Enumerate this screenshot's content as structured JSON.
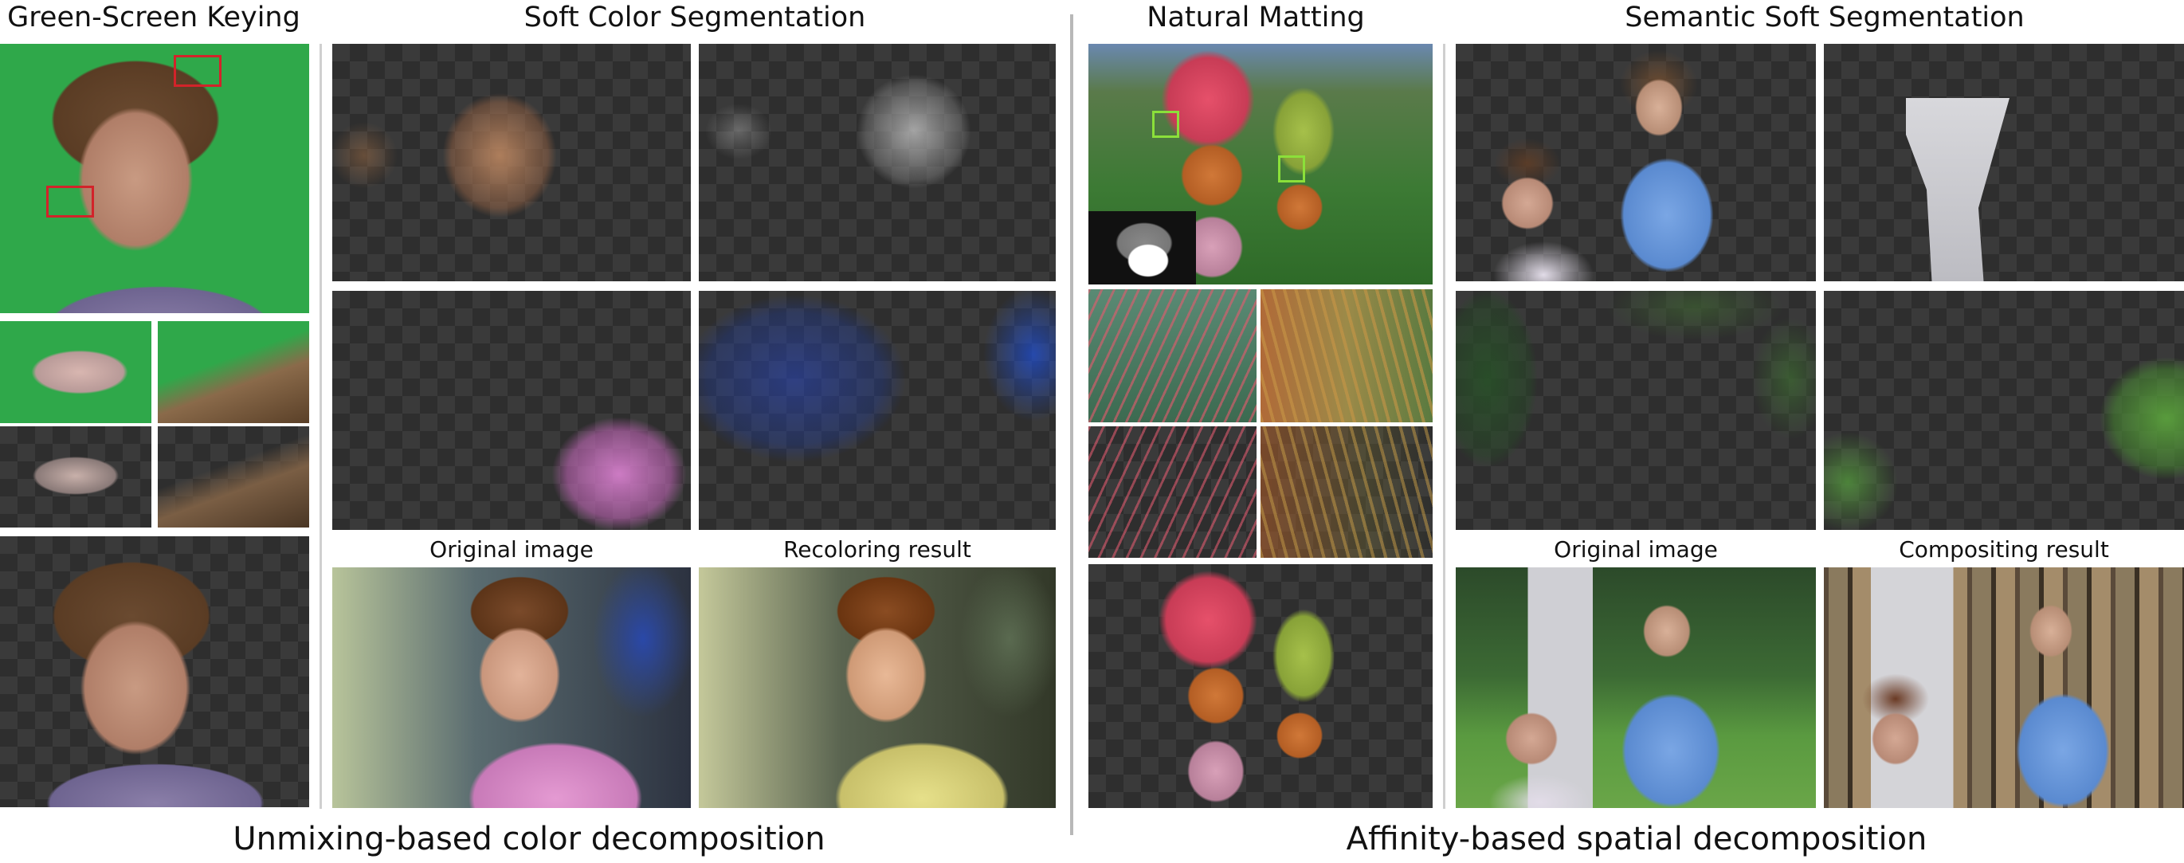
{
  "headings": {
    "green_screen": "Green-Screen Keying",
    "soft_color": "Soft Color Segmentation",
    "natural_matting": "Natural Matting",
    "semantic_soft": "Semantic Soft Segmentation"
  },
  "sublabels": {
    "original_left": "Original image",
    "recoloring": "Recoloring result",
    "original_right": "Original image",
    "compositing": "Compositing result"
  },
  "captions": {
    "left": "Unmixing-based color decomposition",
    "right": "Affinity-based spatial decomposition"
  },
  "colors": {
    "green_screen": "#2fa84a",
    "box_red": "#d2232a",
    "box_green": "#8be03a",
    "checker_dark": "#2e2e2e",
    "checker_light": "#3a3a3a",
    "divider": "#cfcfcf"
  }
}
